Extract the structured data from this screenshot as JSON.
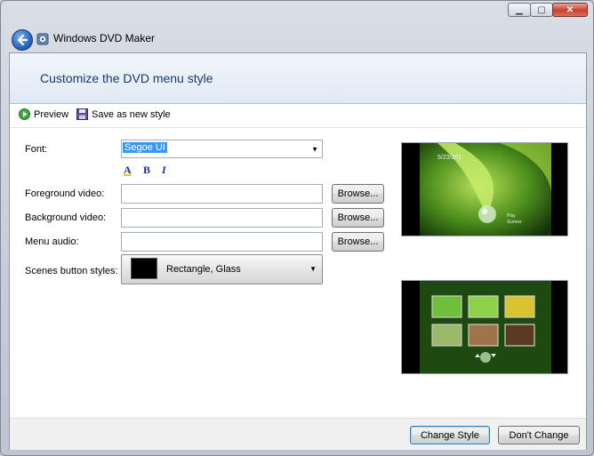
{
  "window": {
    "app_title": "Windows DVD Maker",
    "minimize_glyph": "▁",
    "maximize_glyph": "▢",
    "close_glyph": "✕"
  },
  "header": {
    "title": "Customize the DVD menu style"
  },
  "toolbar": {
    "preview_label": "Preview",
    "save_label": "Save as new style"
  },
  "form": {
    "font_label": "Font:",
    "font_value": "Segoe UI",
    "format": {
      "color_glyph": "A",
      "bold_glyph": "B",
      "italic_glyph": "I"
    },
    "foreground_label": "Foreground video:",
    "foreground_value": "",
    "background_label": "Background video:",
    "background_value": "",
    "audio_label": "Menu audio:",
    "audio_value": "",
    "browse_label": "Browse...",
    "scenes_label": "Scenes button styles:",
    "scenes_value": "Rectangle, Glass"
  },
  "preview": {
    "menu_date": "5/23/201",
    "menu_items": [
      "Play",
      "Scenes"
    ]
  },
  "footer": {
    "change_style_label": "Change Style",
    "dont_change_label": "Don't Change"
  }
}
